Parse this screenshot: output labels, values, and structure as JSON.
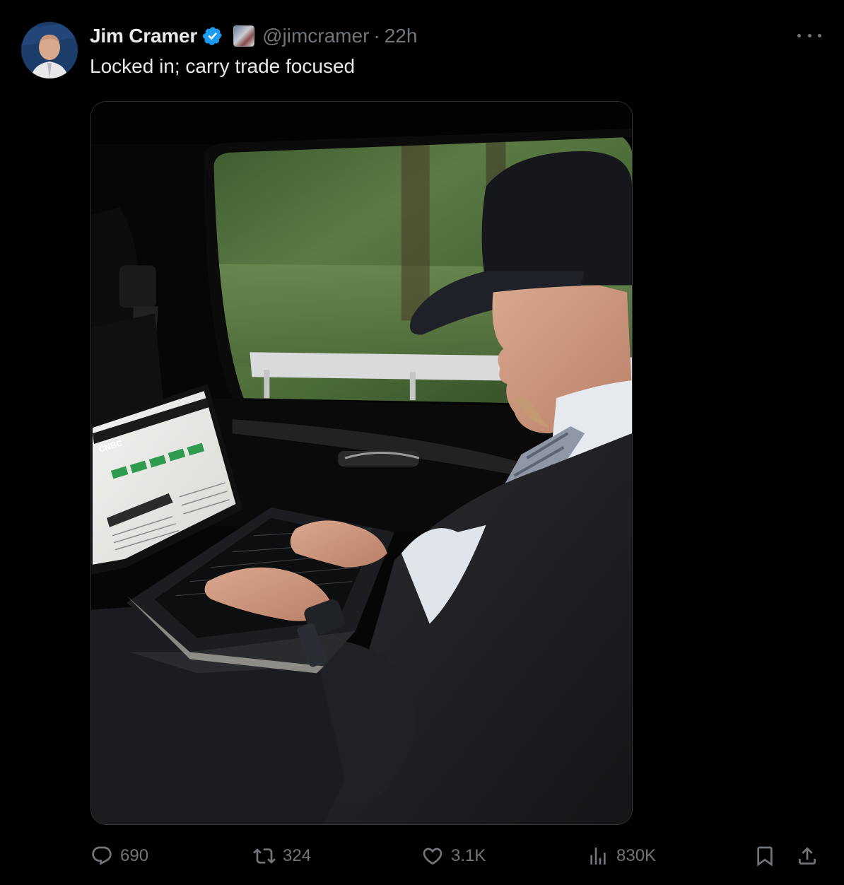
{
  "author": {
    "display_name": "Jim Cramer",
    "handle": "@jimcramer",
    "separator": "·",
    "timestamp": "22h",
    "verified": true
  },
  "tweet": {
    "text": "Locked in; carry trade focused"
  },
  "media": {
    "screen_brand": "CNBC"
  },
  "actions": {
    "replies": "690",
    "retweets": "324",
    "likes": "3.1K",
    "views": "830K"
  },
  "icons": {
    "more": "more-dots-icon",
    "verified": "verified-badge-icon",
    "reply": "reply-icon",
    "retweet": "retweet-icon",
    "like": "heart-icon",
    "views": "views-icon",
    "bookmark": "bookmark-icon",
    "share": "share-icon"
  },
  "colors": {
    "background": "#000000",
    "text": "#e7e9ea",
    "muted": "#71767b",
    "verified": "#1d9bf0"
  }
}
